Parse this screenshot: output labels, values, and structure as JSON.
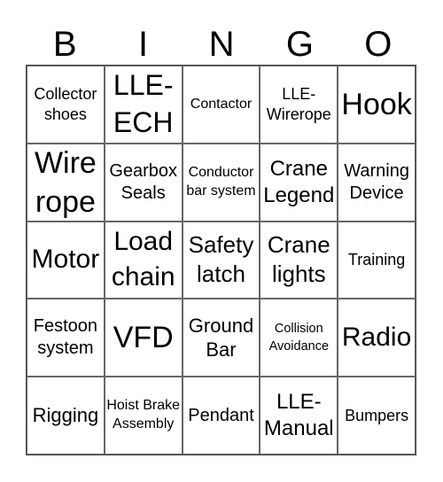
{
  "header": {
    "letters": [
      "B",
      "I",
      "N",
      "G",
      "O"
    ]
  },
  "grid": {
    "rows": [
      [
        "Collector shoes",
        "LLE- ECH",
        "Contactor",
        "LLE- Wirerope",
        "Hook"
      ],
      [
        "Wire rope",
        "Gearbox Seals",
        "Conductor bar system",
        "Crane Legend",
        "Warning Device"
      ],
      [
        "Motor",
        "Load chain",
        "Safety latch",
        "Crane lights",
        "Training"
      ],
      [
        "Festoon system",
        "VFD",
        "Ground Bar",
        "Collision Avoidance",
        "Radio"
      ],
      [
        "Rigging",
        "Hoist Brake Assembly",
        "Pendant",
        "LLE- Manual",
        "Bumpers"
      ]
    ]
  }
}
